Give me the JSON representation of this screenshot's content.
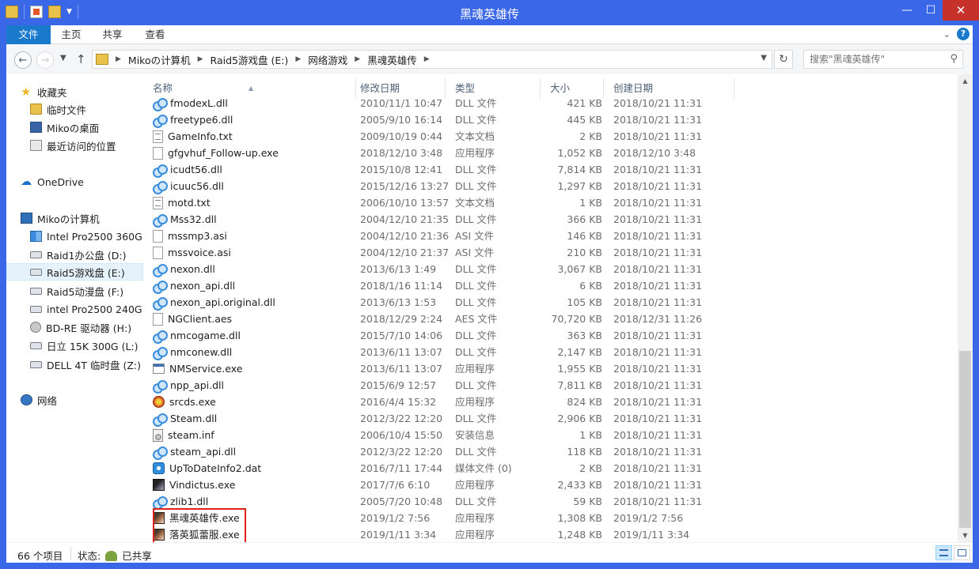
{
  "window": {
    "title": "黑魂英雄传",
    "minimize_glyph": "—",
    "maximize_glyph": "☐",
    "close_glyph": "✕"
  },
  "ribbon": {
    "tabs": [
      {
        "label": "文件"
      },
      {
        "label": "主页"
      },
      {
        "label": "共享"
      },
      {
        "label": "查看"
      }
    ],
    "help_glyph": "?"
  },
  "address_bar": {
    "breadcrumbs": [
      "Mikoの计算机",
      "Raid5游戏盘 (E:)",
      "网络游戏",
      "黑魂英雄传"
    ]
  },
  "search": {
    "placeholder": "搜索\"黑魂英雄传\""
  },
  "nav_pane": {
    "favorites_label": "收藏夹",
    "favorites": [
      "临时文件",
      "Mikoの桌面",
      "最近访问的位置"
    ],
    "onedrive_label": "OneDrive",
    "computer_label": "Mikoの计算机",
    "drives": [
      "Intel Pro2500 360G",
      "Raid1办公盘 (D:)",
      "Raid5游戏盘 (E:)",
      "Raid5动漫盘 (F:)",
      "intel Pro2500 240G",
      "BD-RE 驱动器 (H:)",
      "日立 15K 300G (L:)",
      "DELL 4T 临时盘 (Z:)"
    ],
    "network_label": "网络"
  },
  "columns": {
    "name": "名称",
    "modified": "修改日期",
    "type": "类型",
    "size": "大小",
    "created": "创建日期"
  },
  "files": [
    {
      "name": "fmodexL.dll",
      "modified": "2010/11/1 10:47",
      "type": "DLL 文件",
      "size": "421 KB",
      "created": "2018/10/21 11:31",
      "icon": "dll"
    },
    {
      "name": "freetype6.dll",
      "modified": "2005/9/10 16:14",
      "type": "DLL 文件",
      "size": "445 KB",
      "created": "2018/10/21 11:31",
      "icon": "dll"
    },
    {
      "name": "GameInfo.txt",
      "modified": "2009/10/19 0:44",
      "type": "文本文档",
      "size": "2 KB",
      "created": "2018/10/21 11:31",
      "icon": "txt"
    },
    {
      "name": "gfgvhuf_Follow-up.exe",
      "modified": "2018/12/10 3:48",
      "type": "应用程序",
      "size": "1,052 KB",
      "created": "2018/12/10 3:48",
      "icon": "blank"
    },
    {
      "name": "icudt56.dll",
      "modified": "2015/10/8 12:41",
      "type": "DLL 文件",
      "size": "7,814 KB",
      "created": "2018/10/21 11:31",
      "icon": "dll"
    },
    {
      "name": "icuuc56.dll",
      "modified": "2015/12/16 13:27",
      "type": "DLL 文件",
      "size": "1,297 KB",
      "created": "2018/10/21 11:31",
      "icon": "dll"
    },
    {
      "name": "motd.txt",
      "modified": "2006/10/10 13:57",
      "type": "文本文档",
      "size": "1 KB",
      "created": "2018/10/21 11:31",
      "icon": "txt"
    },
    {
      "name": "Mss32.dll",
      "modified": "2004/12/10 21:35",
      "type": "DLL 文件",
      "size": "366 KB",
      "created": "2018/10/21 11:31",
      "icon": "dll"
    },
    {
      "name": "mssmp3.asi",
      "modified": "2004/12/10 21:36",
      "type": "ASI 文件",
      "size": "146 KB",
      "created": "2018/10/21 11:31",
      "icon": "blank"
    },
    {
      "name": "mssvoice.asi",
      "modified": "2004/12/10 21:37",
      "type": "ASI 文件",
      "size": "210 KB",
      "created": "2018/10/21 11:31",
      "icon": "blank"
    },
    {
      "name": "nexon.dll",
      "modified": "2013/6/13 1:49",
      "type": "DLL 文件",
      "size": "3,067 KB",
      "created": "2018/10/21 11:31",
      "icon": "dll"
    },
    {
      "name": "nexon_api.dll",
      "modified": "2018/1/16 11:14",
      "type": "DLL 文件",
      "size": "6 KB",
      "created": "2018/10/21 11:31",
      "icon": "dll"
    },
    {
      "name": "nexon_api.original.dll",
      "modified": "2013/6/13 1:53",
      "type": "DLL 文件",
      "size": "105 KB",
      "created": "2018/10/21 11:31",
      "icon": "dll"
    },
    {
      "name": "NGClient.aes",
      "modified": "2018/12/29 2:24",
      "type": "AES 文件",
      "size": "70,720 KB",
      "created": "2018/12/31 11:26",
      "icon": "blank"
    },
    {
      "name": "nmcogame.dll",
      "modified": "2015/7/10 14:06",
      "type": "DLL 文件",
      "size": "363 KB",
      "created": "2018/10/21 11:31",
      "icon": "dll"
    },
    {
      "name": "nmconew.dll",
      "modified": "2013/6/11 13:07",
      "type": "DLL 文件",
      "size": "2,147 KB",
      "created": "2018/10/21 11:31",
      "icon": "dll"
    },
    {
      "name": "NMService.exe",
      "modified": "2013/6/11 13:07",
      "type": "应用程序",
      "size": "1,955 KB",
      "created": "2018/10/21 11:31",
      "icon": "exe"
    },
    {
      "name": "npp_api.dll",
      "modified": "2015/6/9 12:57",
      "type": "DLL 文件",
      "size": "7,811 KB",
      "created": "2018/10/21 11:31",
      "icon": "dll"
    },
    {
      "name": "srcds.exe",
      "modified": "2016/4/4 15:32",
      "type": "应用程序",
      "size": "824 KB",
      "created": "2018/10/21 11:31",
      "icon": "src"
    },
    {
      "name": "Steam.dll",
      "modified": "2012/3/22 12:20",
      "type": "DLL 文件",
      "size": "2,906 KB",
      "created": "2018/10/21 11:31",
      "icon": "dll"
    },
    {
      "name": "steam.inf",
      "modified": "2006/10/4 15:50",
      "type": "安装信息",
      "size": "1 KB",
      "created": "2018/10/21 11:31",
      "icon": "inf"
    },
    {
      "name": "steam_api.dll",
      "modified": "2012/3/22 12:20",
      "type": "DLL 文件",
      "size": "118 KB",
      "created": "2018/10/21 11:31",
      "icon": "dll"
    },
    {
      "name": "UpToDateInfo2.dat",
      "modified": "2016/7/11 17:44",
      "type": "媒体文件 (0)",
      "size": "2 KB",
      "created": "2018/10/21 11:31",
      "icon": "steam"
    },
    {
      "name": "Vindictus.exe",
      "modified": "2017/7/6 6:10",
      "type": "应用程序",
      "size": "2,433 KB",
      "created": "2018/10/21 11:31",
      "icon": "vind"
    },
    {
      "name": "zlib1.dll",
      "modified": "2005/7/20 10:48",
      "type": "DLL 文件",
      "size": "59 KB",
      "created": "2018/10/21 11:31",
      "icon": "dll"
    },
    {
      "name": "黑魂英雄传.exe",
      "modified": "2019/1/2 7:56",
      "type": "应用程序",
      "size": "1,308 KB",
      "created": "2019/1/2 7:56",
      "icon": "game"
    },
    {
      "name": "落英狐蕾服.exe",
      "modified": "2019/1/11 3:34",
      "type": "应用程序",
      "size": "1,248 KB",
      "created": "2019/1/11 3:34",
      "icon": "game"
    }
  ],
  "status": {
    "count": "66 个项目",
    "state_label": "状态:",
    "state_value": "已共享"
  }
}
